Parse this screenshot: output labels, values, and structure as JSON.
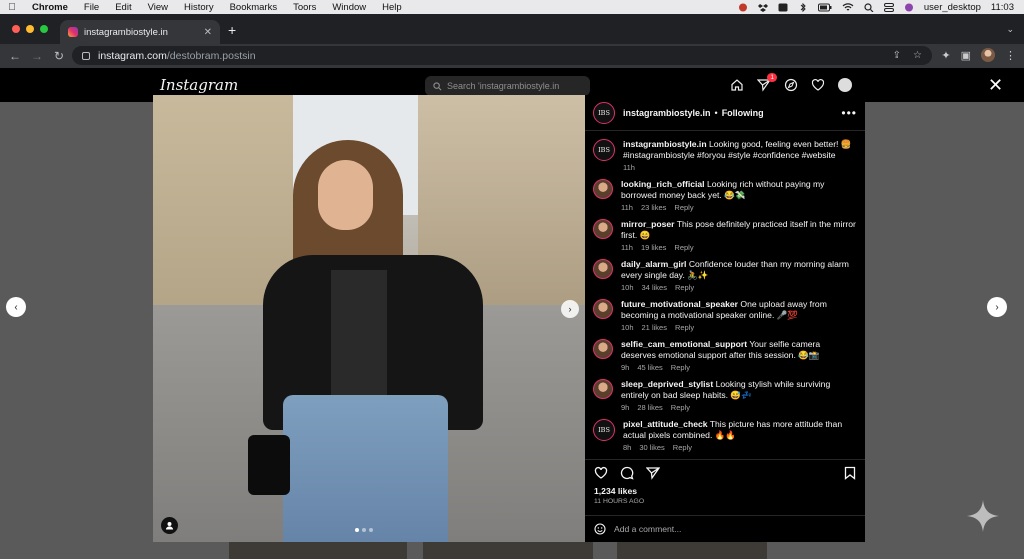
{
  "menubar": {
    "app": "Chrome",
    "items": [
      "File",
      "Edit",
      "View",
      "History",
      "Bookmarks",
      "Toors",
      "Window",
      "Help"
    ],
    "user": "user_desktop",
    "clock": "11:03"
  },
  "browser": {
    "tab_title": "instagrambiostyle.in",
    "url_host": "instagram.com",
    "url_path": "/destobram.postsin"
  },
  "instagram": {
    "logo": "Instagram",
    "search_placeholder": "Search 'instagrambiostyle.in",
    "notification_count": "1"
  },
  "post": {
    "avatar_text": "IBS",
    "username": "instagrambiostyle.in",
    "separator": "•",
    "follow_status": "Following",
    "more": "•••",
    "caption": {
      "user": "instagrambiostyle.in",
      "text": "Looking good, feeling even better! 🍔",
      "tags": "#instagrambiostyle #foryou #style #confidence #website",
      "time": "11h"
    },
    "comments": [
      {
        "user": "looking_rich_official",
        "text": "Looking rich without paying my borrowed money back yet. 😂💸",
        "time": "11h",
        "likes": "23 likes",
        "reply": "Reply",
        "avatar": "face"
      },
      {
        "user": "mirror_poser",
        "text": "This pose definitely practiced itself in the mirror first. 😄",
        "time": "11h",
        "likes": "19 likes",
        "reply": "Reply",
        "avatar": "face"
      },
      {
        "user": "daily_alarm_girl",
        "text": "Confidence louder than my morning alarm every single day. 🚴✨",
        "time": "10h",
        "likes": "34 likes",
        "reply": "Reply",
        "avatar": "face"
      },
      {
        "user": "future_motivational_speaker",
        "text": "One upload away from becoming a motivational speaker online. 🎤💯",
        "time": "10h",
        "likes": "21 likes",
        "reply": "Reply",
        "avatar": "face"
      },
      {
        "user": "selfie_cam_emotional_support",
        "text": "Your selfie camera deserves emotional support after this session. 😂📸",
        "time": "9h",
        "likes": "45 likes",
        "reply": "Reply",
        "avatar": "face"
      },
      {
        "user": "sleep_deprived_stylist",
        "text": "Looking stylish while surviving entirely on bad sleep habits. 😅💤",
        "time": "9h",
        "likes": "28 likes",
        "reply": "Reply",
        "avatar": "face"
      },
      {
        "user": "pixel_attitude_check",
        "text": "This picture has more attitude than actual pixels combined. 🔥🔥",
        "time": "8h",
        "likes": "30 likes",
        "reply": "Reply",
        "avatar": "ibs"
      }
    ],
    "likes": "1,234 likes",
    "posted": "11 HOURS AGO",
    "comment_placeholder": "Add a comment..."
  },
  "colors": {
    "ring": "#e1306c",
    "badge": "#ff3040",
    "panel_bg": "#000000",
    "overlay": "#5a5a5a"
  }
}
